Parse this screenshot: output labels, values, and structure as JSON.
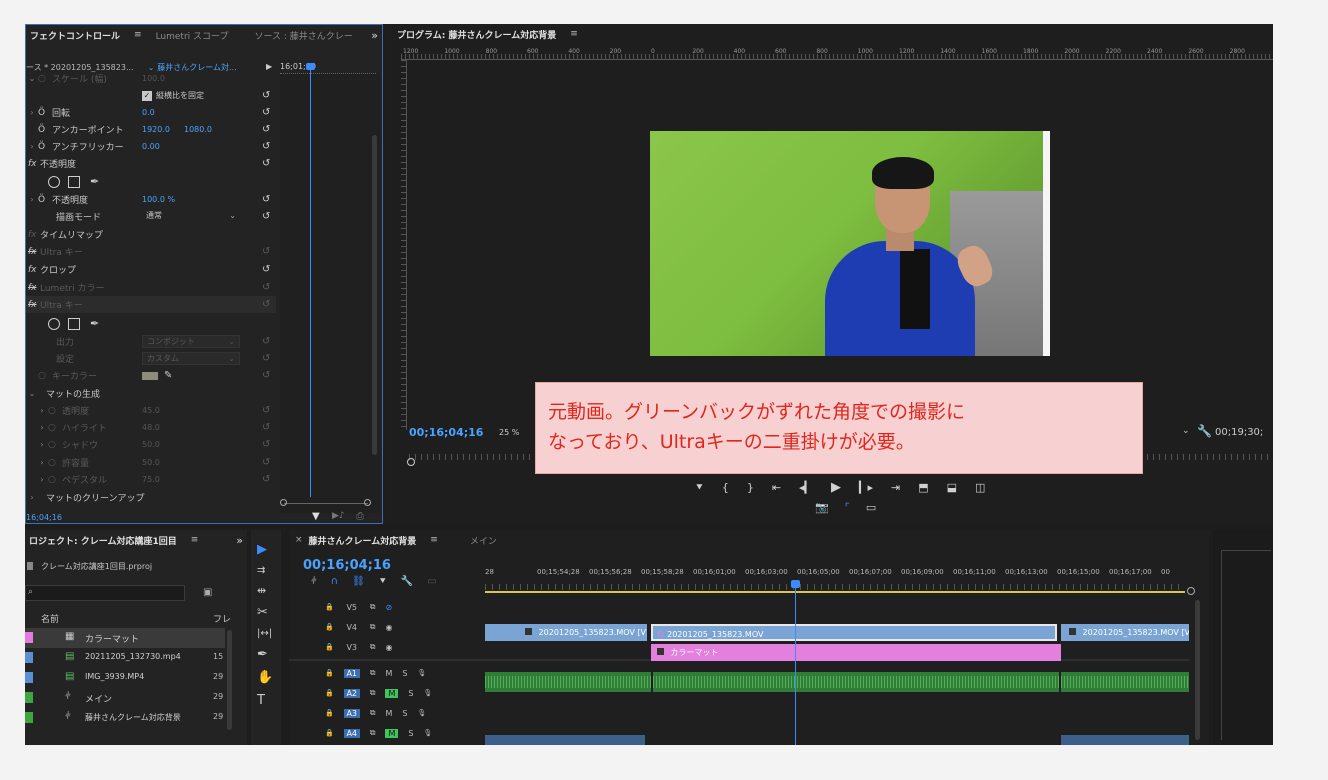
{
  "effect_controls": {
    "tabs": [
      "フェクトコントロール",
      "Lumetri スコープ",
      "ソース : 藤井さんクレー"
    ],
    "more_glyph": "»",
    "source_label": "ース * 20201205_135823...",
    "sequence_label": "藤井さんクレーム対...",
    "timecode_small": "16;01;00",
    "scale_label": "スケール (幅)",
    "scale_value": "100.0",
    "uniform_scale_label": "縦横比を固定",
    "rotation_label": "回転",
    "rotation_value": "0.0",
    "anchor_label": "アンカーポイント",
    "anchor_x": "1920.0",
    "anchor_y": "1080.0",
    "antiflicker_label": "アンチフリッカー",
    "antiflicker_value": "0.00",
    "opacity_section": "不透明度",
    "opacity_label": "不透明度",
    "opacity_value": "100.0 %",
    "blend_label": "描画モード",
    "blend_value": "通常",
    "time_remap": "タイムリマップ",
    "ultra_key_1": "Ultra キー",
    "crop": "クロップ",
    "lumetri_color": "Lumetri カラー",
    "ultra_key_2": "Ultra キー",
    "output_label": "出力",
    "output_value": "コンポジット",
    "setting_label": "設定",
    "setting_value": "カスタム",
    "key_color_label": "キーカラー",
    "matte_gen": "マットの生成",
    "transparency_label": "透明度",
    "transparency_value": "45.0",
    "highlight_label": "ハイライト",
    "highlight_value": "48.0",
    "shadow_label": "シャドウ",
    "shadow_value": "50.0",
    "tolerance_label": "許容量",
    "tolerance_value": "50.0",
    "pedestal_label": "ペデスタル",
    "pedestal_value": "75.0",
    "matte_cleanup": "マットのクリーンアップ",
    "bottom_timecode": "16;04;16"
  },
  "program": {
    "title": "プログラム: 藤井さんクレーム対応背景",
    "menu_glyph": "≡",
    "ruler_labels": [
      "1200",
      "1000",
      "800",
      "600",
      "400",
      "200",
      "0",
      "200",
      "400",
      "600",
      "800",
      "1000",
      "1200",
      "1400",
      "1600",
      "1800",
      "2000",
      "2200",
      "2400",
      "2600",
      "2800"
    ],
    "timecode": "00;16;04;16",
    "zoom": "25 %",
    "end_timecode": "00;19;30;"
  },
  "annotation": {
    "line1": "元動画。グリーンバックがずれた角度での撮影に",
    "line2": "なっており、Ultraキーの二重掛けが必要。"
  },
  "project": {
    "title": "ロジェクト: クレーム対応講座1回目",
    "menu_glyph": "≡",
    "more_glyph": "»",
    "file": "クレーム対応講座1回目.prproj",
    "col_name": "名前",
    "col_fps": "フレ",
    "items": [
      {
        "name": "カラーマット",
        "fps": "",
        "color": "#e57be0"
      },
      {
        "name": "20211205_132730.mp4",
        "fps": "15",
        "color": "#5a8fd6"
      },
      {
        "name": "IMG_3939.MP4",
        "fps": "29",
        "color": "#5a8fd6"
      },
      {
        "name": "メイン",
        "fps": "29",
        "color": "#3fa540"
      },
      {
        "name": "藤井さんクレーム対応背景",
        "fps": "29",
        "color": "#3fa540"
      }
    ]
  },
  "timeline": {
    "tabs": [
      "藤井さんクレーム対応背景",
      "メイン"
    ],
    "close_glyph": "×",
    "menu_glyph": "≡",
    "timecode": "00;16;04;16",
    "ruler": [
      "28",
      "00;15;54;28",
      "00;15;56;28",
      "00;15;58;28",
      "00;16;01;00",
      "00;16;03;00",
      "00;16;05;00",
      "00;16;07;00",
      "00;16;09;00",
      "00;16;11;00",
      "00;16;13;00",
      "00;16;15;00",
      "00;16;17;00",
      "00"
    ],
    "video_tracks": [
      "V5",
      "V4",
      "V3"
    ],
    "audio_tracks": [
      "A1",
      "A2",
      "A3",
      "A4"
    ],
    "clip_v4_a": "20201205_135823.MOV [V]",
    "clip_v4_b": "20201205_135823.MOV",
    "clip_v4_c": "20201205_135823.MOV [V",
    "clip_v3": "カラーマット",
    "m_label": "M",
    "s_label": "S"
  },
  "colors": {
    "accent": "#4aa3ff",
    "video_clip": "#7aa4d4",
    "matte_clip": "#e37fdc",
    "audio_clip": "#2f7d36"
  }
}
